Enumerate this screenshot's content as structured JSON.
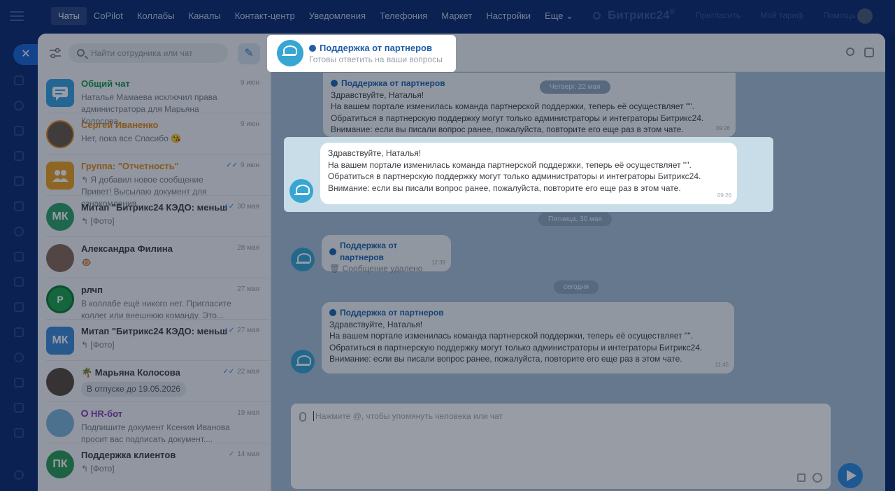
{
  "nav": {
    "items": [
      "Чаты",
      "CoPilot",
      "Коллабы",
      "Каналы",
      "Контакт-центр",
      "Уведомления",
      "Телефония",
      "Маркет",
      "Настройки",
      "Еще ⌄"
    ],
    "brand": "Битрикс24",
    "brand_suffix": "®",
    "invite": "Пригласить",
    "my_plan": "Мой тариф",
    "help": "Помощь"
  },
  "sidebar": {
    "search_placeholder": "Найти сотрудника или чат",
    "chats": [
      {
        "name": "Общий чат",
        "date": "9 июн",
        "preview": "Наталья Мамаева исключил права администратора для Марьяна Колосова.",
        "color": "#1a9a4c",
        "avatar": "chat-bubble"
      },
      {
        "name": "Сергей Иваненко",
        "date": "9 июн",
        "preview": "Нет, пока все Спасибо 😘",
        "color": "#e58b15",
        "avatar": "photo"
      },
      {
        "name": "Группа: \"Отчетность\"",
        "date": "9 июн",
        "preview": "↰ Я добавил новое сообщение Привет! Высылаю документ для ознакомления....",
        "color": "#e58b15",
        "avatar": "group"
      },
      {
        "name": "Митап \"Битрикс24 КЭДО: меньш...",
        "date": "30 мая",
        "preview": "↰ [Фото]",
        "initials": "МК",
        "avatar_color": "#31a36c"
      },
      {
        "name": "Александра Филина",
        "date": "28 мая",
        "preview": "🐵",
        "avatar": "photo"
      },
      {
        "name": "рлчп",
        "date": "27 мая",
        "preview": "В коллабе ещё никого нет. Пригласите коллег или внешнюю команду. Это...",
        "initials": "Р",
        "avatar_color": "#1fa34c"
      },
      {
        "name": "Митап \"Битрикс24 КЭДО: меньш...",
        "date": "27 мая",
        "preview": "↰ [Фото]",
        "initials": "МК",
        "avatar_color": "#3e8cd8"
      },
      {
        "name": "🌴 Марьяна Колосова",
        "date": "22 мая",
        "badge": "В отпуске до 19.05.2026",
        "avatar": "photo"
      },
      {
        "name": "HR-бот",
        "date": "19 мая",
        "preview": "Подпишите документ Ксения Иванова просит вас подписать документ....",
        "color": "#8a3fb8",
        "avatar": "bot"
      },
      {
        "name": "Поддержка клиентов",
        "date": "14 мая",
        "preview": "↰ [Фото]",
        "initials": "ПК",
        "avatar_color": "#2e9d57"
      }
    ]
  },
  "chat": {
    "title": "Поддержка от партнеров",
    "subtitle": "Готовы ответить на ваши вопросы",
    "composer_placeholder": "Нажмите @, чтобы упомянуть человека или чат",
    "dates": [
      "Четверг, 22 мая",
      "Пятница, 30 мая",
      "сегодня"
    ],
    "messages": [
      {
        "sender": "Поддержка от партнеров",
        "lines": [
          "Здравствуйте, Наталья!",
          "На вашем портале изменилась команда партнерской поддержки, теперь её осуществляет \"\".",
          "Обратиться в партнерскую поддержку могут только администраторы и интеграторы Битрикс24.",
          "Внимание: если вы писали вопрос ранее, пожалуйста, повторите его еще раз в этом чате."
        ],
        "time": "09:26"
      },
      {
        "lines": [
          "Здравствуйте, Наталья!",
          "На вашем портале изменилась команда партнерской поддержки, теперь её осуществляет \"\".",
          "Обратиться в партнерскую поддержку могут только администраторы и интеграторы Битрикс24.",
          "Внимание: если вы писали вопрос ранее, пожалуйста, повторите его еще раз в этом чате."
        ],
        "time": "09:26"
      },
      {
        "sender": "Поддержка от партнеров",
        "text": "Сообщение удалено",
        "time": "12:39"
      },
      {
        "sender": "Поддержка от партнеров",
        "lines": [
          "Здравствуйте, Наталья!",
          "На вашем портале изменилась команда партнерской поддержки, теперь её осуществляет \"\".",
          "Обратиться в партнерскую поддержку могут только администраторы и интеграторы Битрикс24.",
          "Внимание: если вы писали вопрос ранее, пожалуйста, повторите его еще раз в этом чате."
        ],
        "time": "11:45"
      }
    ]
  }
}
